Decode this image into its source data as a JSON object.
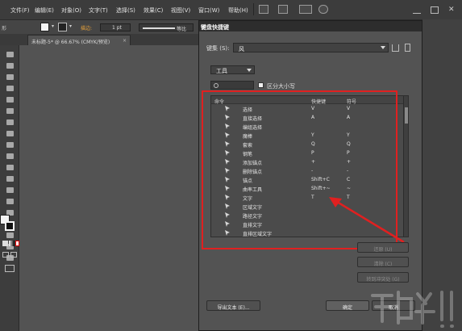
{
  "menubar": {
    "items": [
      "文件(F)",
      "编辑(E)",
      "对象(O)",
      "文字(T)",
      "选择(S)",
      "效果(C)",
      "视图(V)",
      "窗口(W)",
      "帮助(H)"
    ]
  },
  "controlbar": {
    "left_label": "形",
    "stroke_label": "描边:",
    "stroke_value": "1 pt",
    "profile_label": "等比"
  },
  "document_tab": {
    "title": "未标题-5* @ 66.67% (CMYK/预览)",
    "close": "×"
  },
  "dialog": {
    "title": "键盘快捷键",
    "close": "×",
    "keyset_label": "键集 (S):",
    "keyset_value": "风",
    "category_value": "工具",
    "search_placeholder": "",
    "case_label": "区分大小写",
    "table": {
      "headers": [
        "命令",
        "快捷键",
        "符号"
      ],
      "rows": [
        {
          "icon": "selection-arrow-icon",
          "command": "选择",
          "shortcut": "V",
          "symbol": "V"
        },
        {
          "icon": "direct-selection-icon",
          "command": "直接选择",
          "shortcut": "A",
          "symbol": "A"
        },
        {
          "icon": "group-selection-icon",
          "command": "编组选择",
          "shortcut": "",
          "symbol": ""
        },
        {
          "icon": "magic-wand-icon",
          "command": "魔棒",
          "shortcut": "Y",
          "symbol": "Y"
        },
        {
          "icon": "lasso-icon",
          "command": "套索",
          "shortcut": "Q",
          "symbol": "Q"
        },
        {
          "icon": "pen-icon",
          "command": "钢笔",
          "shortcut": "P",
          "symbol": "P"
        },
        {
          "icon": "add-anchor-icon",
          "command": "添加锚点",
          "shortcut": "+",
          "symbol": "+"
        },
        {
          "icon": "delete-anchor-icon",
          "command": "删除锚点",
          "shortcut": "-",
          "symbol": "-"
        },
        {
          "icon": "anchor-point-icon",
          "command": "锚点",
          "shortcut": "Shift+C",
          "symbol": "C"
        },
        {
          "icon": "curvature-icon",
          "command": "曲率工具",
          "shortcut": "Shift+~",
          "symbol": "~"
        },
        {
          "icon": "type-icon",
          "command": "文字",
          "shortcut": "T",
          "symbol": "T"
        },
        {
          "icon": "area-type-icon",
          "command": "区域文字",
          "shortcut": "",
          "symbol": ""
        },
        {
          "icon": "path-type-icon",
          "command": "路径文字",
          "shortcut": "",
          "symbol": ""
        },
        {
          "icon": "vertical-type-icon",
          "command": "直排文字",
          "shortcut": "",
          "symbol": ""
        },
        {
          "icon": "vertical-area-type-icon",
          "command": "直排区域文字",
          "shortcut": "",
          "symbol": ""
        }
      ]
    },
    "buttons": {
      "undo": "还原 (U)",
      "clear": "清除 (C)",
      "goto_conflict": "转到冲突处 (G)",
      "export_text": "导出文本 (E)...",
      "ok": "确定",
      "cancel": "取消"
    }
  },
  "colors": {
    "highlight": "#e02020",
    "workspace": "#535353"
  }
}
